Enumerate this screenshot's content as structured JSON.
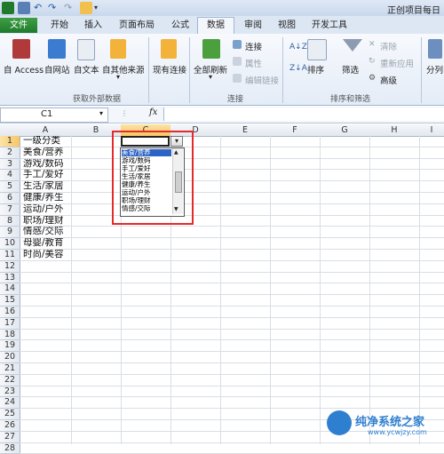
{
  "title_bar": {
    "title": "正创项目每日"
  },
  "tabs": [
    "文件",
    "开始",
    "插入",
    "页面布局",
    "公式",
    "数据",
    "审阅",
    "视图",
    "开发工具"
  ],
  "ribbon": {
    "external_data": {
      "group_label": "获取外部数据",
      "buttons": [
        "自 Access",
        "自网站",
        "自文本",
        "自其他来源",
        "现有连接"
      ]
    },
    "connections": {
      "group_label": "连接",
      "refresh_all": "全部刷新",
      "connections": "连接",
      "properties": "属性",
      "edit_links": "编辑链接"
    },
    "sort_filter": {
      "group_label": "排序和筛选",
      "sort": "排序",
      "filter": "筛选",
      "clear": "清除",
      "reapply": "重新应用",
      "advanced": "高级"
    },
    "data_tools": {
      "split": "分列"
    }
  },
  "formula_bar": {
    "name_box": "C1",
    "fx": "fx",
    "value": ""
  },
  "columns": [
    "A",
    "B",
    "C",
    "D",
    "E",
    "F",
    "G",
    "H",
    "I"
  ],
  "rows": [
    "1",
    "2",
    "3",
    "4",
    "5",
    "6",
    "7",
    "8",
    "9",
    "10",
    "11",
    "12",
    "13",
    "14",
    "15",
    "16",
    "17",
    "18",
    "19",
    "20",
    "21",
    "22",
    "23",
    "24",
    "25",
    "26",
    "27",
    "28"
  ],
  "cells_A": [
    "一级分类",
    "美食/营养",
    "游戏/数码",
    "手工/爱好",
    "生活/家居",
    "健康/养生",
    "运动/户外",
    "职场/理财",
    "情感/交际",
    "母婴/教育",
    "时尚/美容"
  ],
  "dropdown": {
    "selected_index": 0,
    "items": [
      "美食/营养",
      "游戏/数码",
      "手工/爱好",
      "生活/家居",
      "健康/养生",
      "运动/户外",
      "职场/理财",
      "情感/交际"
    ]
  },
  "watermark": {
    "text": "纯净系统之家",
    "url": "www.ycwjzy.com"
  },
  "colors": {
    "file_tab": "#1f7a2c",
    "selection": "#2b63c6",
    "highlight_box": "#e52a2a",
    "active_header": "#f6c665"
  }
}
